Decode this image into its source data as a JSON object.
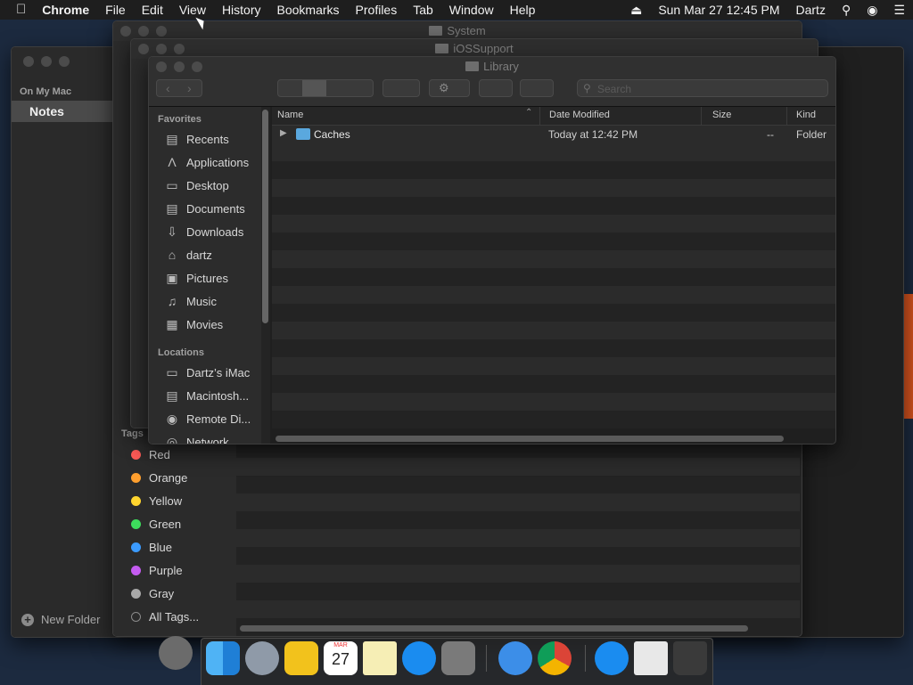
{
  "menubar": {
    "app": "Chrome",
    "items": [
      "File",
      "Edit",
      "View",
      "History",
      "Bookmarks",
      "Profiles",
      "Tab",
      "Window",
      "Help"
    ],
    "datetime": "Sun Mar 27  12:45 PM",
    "user": "Dartz"
  },
  "notes": {
    "section": "On My Mac",
    "folder": "Notes",
    "new_folder": "New Folder"
  },
  "finder_system": {
    "title": "System"
  },
  "finder_ios": {
    "title": "iOSSupport"
  },
  "finder_back": {
    "tags_header": "Tags",
    "tags": [
      {
        "label": "Red",
        "color": "#ff5b57"
      },
      {
        "label": "Orange",
        "color": "#ff9f2e"
      },
      {
        "label": "Yellow",
        "color": "#ffd52e"
      },
      {
        "label": "Green",
        "color": "#3ddc5c"
      },
      {
        "label": "Blue",
        "color": "#3b9bff"
      },
      {
        "label": "Purple",
        "color": "#c45bf0"
      },
      {
        "label": "Gray",
        "color": "#a8a8a8"
      },
      {
        "label": "All Tags...",
        "color": ""
      }
    ]
  },
  "finder": {
    "title": "Library",
    "search_placeholder": "Search",
    "favorites_header": "Favorites",
    "favorites": [
      {
        "label": "Recents",
        "icon": "recents-icon"
      },
      {
        "label": "Applications",
        "icon": "applications-icon"
      },
      {
        "label": "Desktop",
        "icon": "desktop-icon"
      },
      {
        "label": "Documents",
        "icon": "documents-icon"
      },
      {
        "label": "Downloads",
        "icon": "downloads-icon"
      },
      {
        "label": "dartz",
        "icon": "home-icon"
      },
      {
        "label": "Pictures",
        "icon": "pictures-icon"
      },
      {
        "label": "Music",
        "icon": "music-icon"
      },
      {
        "label": "Movies",
        "icon": "movies-icon"
      }
    ],
    "locations_header": "Locations",
    "locations": [
      {
        "label": "Dartz’s iMac",
        "icon": "imac-icon"
      },
      {
        "label": "Macintosh...",
        "icon": "disk-icon"
      },
      {
        "label": "Remote Di...",
        "icon": "remote-disc-icon"
      },
      {
        "label": "Network",
        "icon": "network-icon"
      }
    ],
    "columns": {
      "name": "Name",
      "date": "Date Modified",
      "size": "Size",
      "kind": "Kind"
    },
    "rows": [
      {
        "name": "Caches",
        "date": "Today at 12:42 PM",
        "size": "--",
        "kind": "Folder"
      }
    ]
  },
  "dock": {
    "apps": [
      "Finder",
      "Launchpad",
      "Taxi",
      "Calendar",
      "Notes",
      "App Store",
      "System Preferences",
      "Safari",
      "Chrome",
      "App Store Folder",
      "Documents",
      "Trash"
    ],
    "calendar": {
      "month": "MAR",
      "day": "27"
    }
  }
}
